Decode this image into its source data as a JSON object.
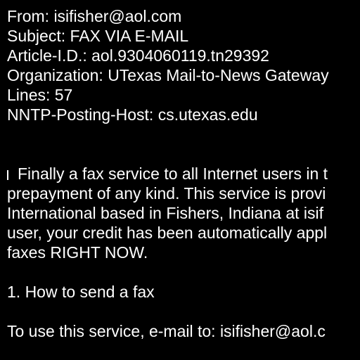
{
  "colors": {
    "background": "#000000",
    "text": "#ffffff"
  },
  "headers": {
    "from": "From: isifisher@aol.com",
    "subject": "Subject: FAX VIA E-MAIL",
    "article_id": "Article-I.D.: aol.9304060119.tn29392",
    "organization": "Organization: UTexas Mail-to-News Gateway",
    "lines": "Lines: 57",
    "nntp_host": "NNTP-Posting-Host: cs.utexas.edu"
  },
  "body": {
    "para1": [
      "Finally a fax service to all Internet users in t",
      "prepayment of any kind. This service is provi",
      "International based in Fishers, Indiana at isif",
      "user, your credit has been automatically appl",
      "faxes RIGHT NOW."
    ],
    "section1_heading": "1. How to send a fax",
    "instruction": "To use this service, e-mail to: isifisher@aol.c"
  }
}
